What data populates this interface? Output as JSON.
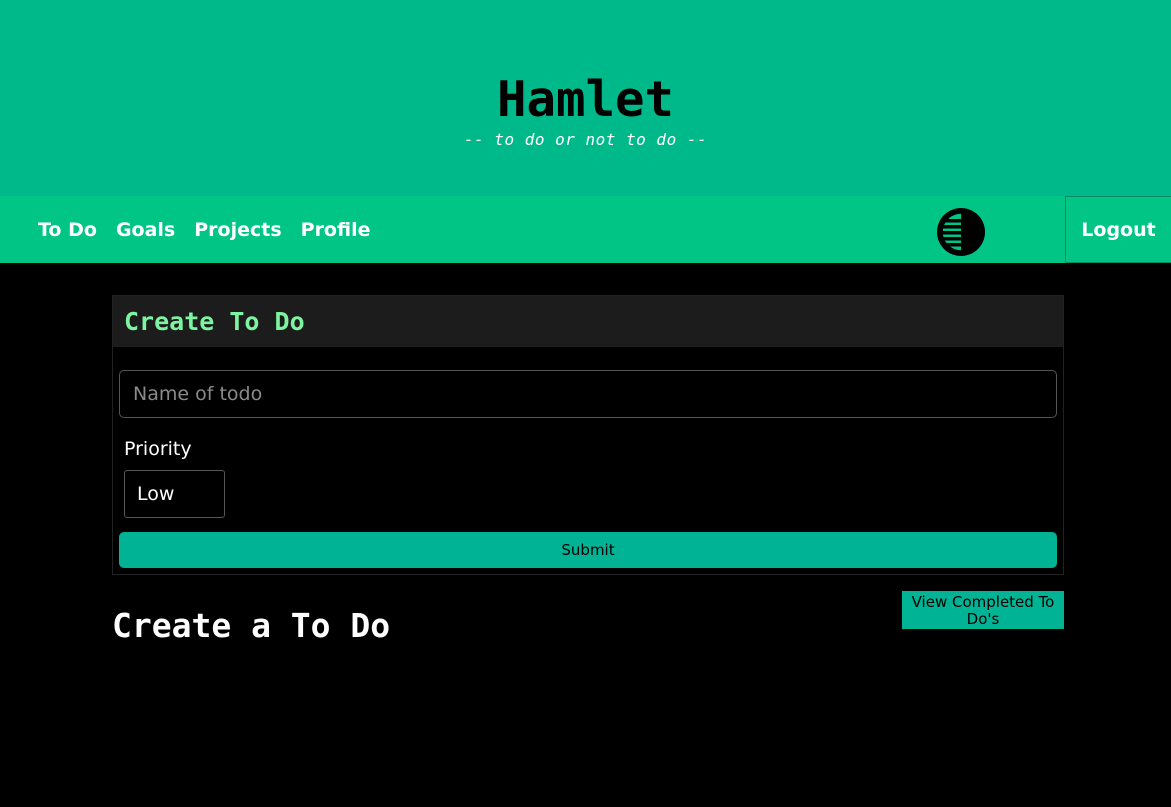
{
  "header": {
    "title": "Hamlet",
    "tagline": "-- to do or not to do --"
  },
  "nav": {
    "items": [
      {
        "label": "To Do"
      },
      {
        "label": "Goals"
      },
      {
        "label": "Projects"
      },
      {
        "label": "Profile"
      }
    ],
    "theme_toggle_icon": "contrast-toggle-icon",
    "logout_label": "Logout"
  },
  "form": {
    "title": "Create To Do",
    "name_placeholder": "Name of todo",
    "name_value": "",
    "priority_label": "Priority",
    "priority_value": "Low",
    "submit_label": "Submit"
  },
  "list": {
    "title": "Create a To Do",
    "view_completed_label": "View Completed To Do's"
  },
  "colors": {
    "header_bg": "#00b98a",
    "nav_bg": "#00c584",
    "accent": "#00b394",
    "card_title": "#7cf4a0",
    "background": "#000000"
  }
}
